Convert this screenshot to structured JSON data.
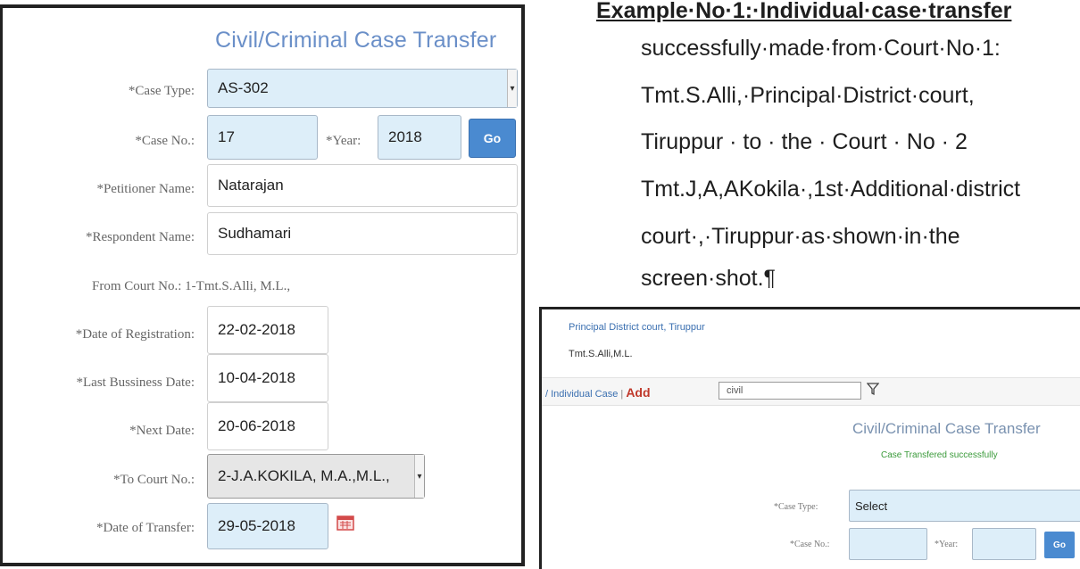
{
  "form": {
    "title": "Civil/Criminal Case Transfer",
    "case_type": {
      "label": "*Case Type:",
      "value": "AS-302"
    },
    "case_no": {
      "label": "*Case No.:",
      "value": "17"
    },
    "year": {
      "label": "*Year:",
      "value": "2018"
    },
    "go_label": "Go",
    "petitioner": {
      "label": "*Petitioner Name:",
      "value": "Natarajan"
    },
    "respondent": {
      "label": "*Respondent Name:",
      "value": "Sudhamari"
    },
    "from_court": "From Court No.: 1-Tmt.S.Alli, M.L.,",
    "registration_date": {
      "label": "*Date of Registration:",
      "value": "22-02-2018"
    },
    "last_business_date": {
      "label": "*Last Bussiness Date:",
      "value": "10-04-2018"
    },
    "next_date": {
      "label": "*Next Date:",
      "value": "20-06-2018"
    },
    "to_court": {
      "label": "*To Court No.:",
      "value": "2-J.A.KOKILA, M.A.,M.L.,"
    },
    "transfer_date": {
      "label": "*Date of Transfer:",
      "value": "29-05-2018"
    }
  },
  "document": {
    "lines": [
      "Example·No·1:·Individual·case·transfer",
      "successfully·made·from·Court·No·1:",
      "Tmt.S.Alli,·Principal·District·court,",
      "Tiruppur · to · the · Court · No · 2",
      "Tmt.J,A,AKokila·,1st·Additional·district",
      "court·,·Tiruppur·as·shown·in·the",
      "screen·shot.¶"
    ]
  },
  "mini": {
    "court": "Principal District court, Tiruppur",
    "judge": "Tmt.S.Alli,M.L.",
    "breadcrumb": "/ Individual Case",
    "breadcrumb_sep": "|",
    "add_label": "Add",
    "search_value": "civil",
    "title": "Civil/Criminal Case Transfer",
    "success": "Case Transfered successfully",
    "case_type_label": "*Case Type:",
    "case_type_value": "Select",
    "case_no_label": "*Case No.:",
    "year_label": "*Year:",
    "go_label": "Go"
  },
  "colors": {
    "field_bg": "#ddeef9",
    "title_blue": "#6a8fc8",
    "go_button": "#4a8ad0",
    "required_red": "#c0392b",
    "success_green": "#3a9a3a"
  }
}
